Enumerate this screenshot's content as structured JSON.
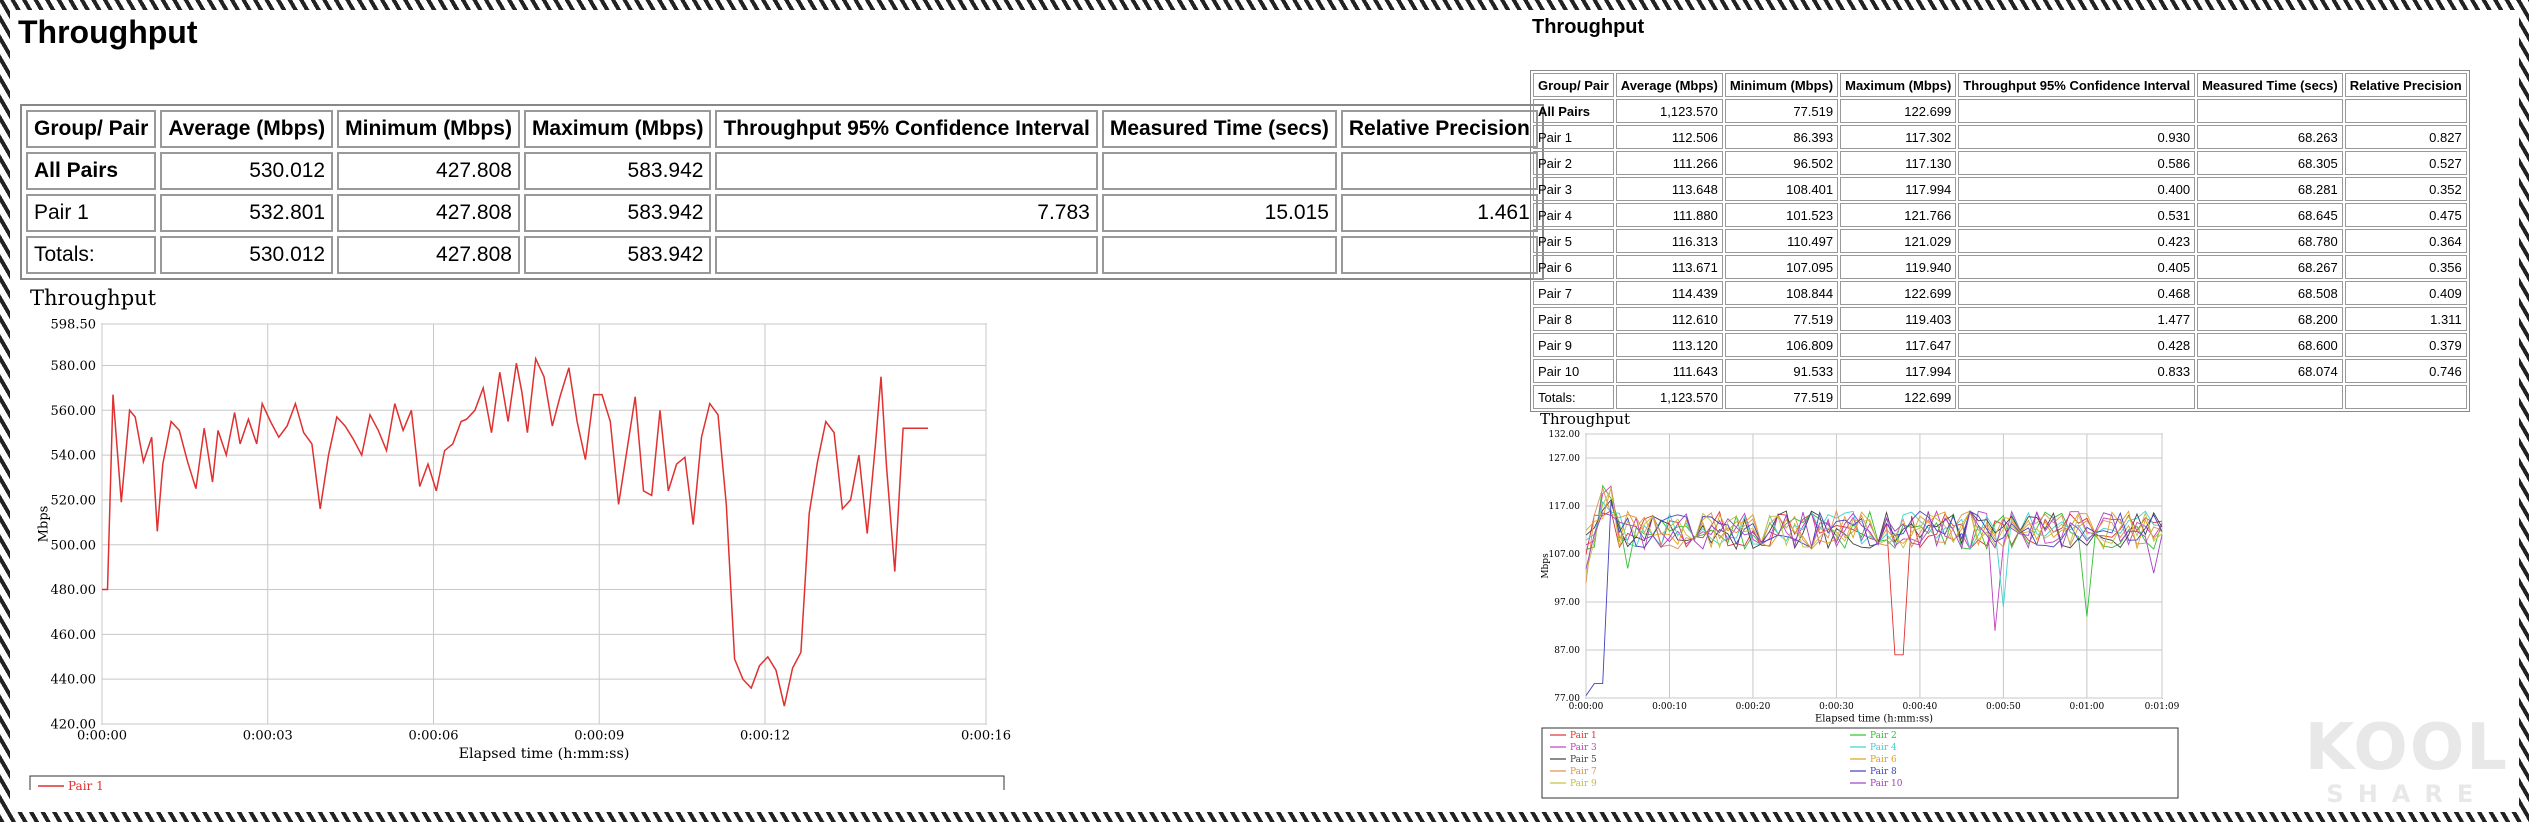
{
  "left": {
    "title": "Throughput",
    "table": {
      "headers": [
        "Group/ Pair",
        "Average (Mbps)",
        "Minimum (Mbps)",
        "Maximum (Mbps)",
        "Throughput 95% Confidence Interval",
        "Measured Time (secs)",
        "Relative Precision"
      ],
      "rows": [
        [
          "All Pairs",
          "530.012",
          "427.808",
          "583.942",
          "",
          "",
          ""
        ],
        [
          "Pair 1",
          "532.801",
          "427.808",
          "583.942",
          "7.783",
          "15.015",
          "1.461"
        ],
        [
          "Totals:",
          "530.012",
          "427.808",
          "583.942",
          "",
          "",
          ""
        ]
      ]
    }
  },
  "right": {
    "title": "Throughput",
    "table": {
      "headers": [
        "Group/ Pair",
        "Average (Mbps)",
        "Minimum (Mbps)",
        "Maximum (Mbps)",
        "Throughput 95% Confidence Interval",
        "Measured Time (secs)",
        "Relative Precision"
      ],
      "rows": [
        [
          "All Pairs",
          "1,123.570",
          "77.519",
          "122.699",
          "",
          "",
          ""
        ],
        [
          "Pair 1",
          "112.506",
          "86.393",
          "117.302",
          "0.930",
          "68.263",
          "0.827"
        ],
        [
          "Pair 2",
          "111.266",
          "96.502",
          "117.130",
          "0.586",
          "68.305",
          "0.527"
        ],
        [
          "Pair 3",
          "113.648",
          "108.401",
          "117.994",
          "0.400",
          "68.281",
          "0.352"
        ],
        [
          "Pair 4",
          "111.880",
          "101.523",
          "121.766",
          "0.531",
          "68.645",
          "0.475"
        ],
        [
          "Pair 5",
          "116.313",
          "110.497",
          "121.029",
          "0.423",
          "68.780",
          "0.364"
        ],
        [
          "Pair 6",
          "113.671",
          "107.095",
          "119.940",
          "0.405",
          "68.267",
          "0.356"
        ],
        [
          "Pair 7",
          "114.439",
          "108.844",
          "122.699",
          "0.468",
          "68.508",
          "0.409"
        ],
        [
          "Pair 8",
          "112.610",
          "77.519",
          "119.403",
          "1.477",
          "68.200",
          "1.311"
        ],
        [
          "Pair 9",
          "113.120",
          "106.809",
          "117.647",
          "0.428",
          "68.600",
          "0.379"
        ],
        [
          "Pair 10",
          "111.643",
          "91.533",
          "117.994",
          "0.833",
          "68.074",
          "0.746"
        ],
        [
          "Totals:",
          "1,123.570",
          "77.519",
          "122.699",
          "",
          "",
          ""
        ]
      ]
    }
  },
  "chart_data": [
    {
      "type": "line",
      "title": "Throughput",
      "xlabel": "Elapsed time (h:mm:ss)",
      "ylabel": "Mbps",
      "xlim": [
        0,
        16
      ],
      "ylim": [
        420.0,
        598.5
      ],
      "yticks": [
        "598.50",
        "580.00",
        "560.00",
        "540.00",
        "520.00",
        "500.00",
        "480.00",
        "460.00",
        "440.00",
        "420.00"
      ],
      "ytick_values": [
        598.5,
        580,
        560,
        540,
        520,
        500,
        480,
        460,
        440,
        420
      ],
      "xticks": [
        "0:00:00",
        "0:00:03",
        "0:00:06",
        "0:00:09",
        "0:00:12",
        "0:00:16"
      ],
      "xtick_values": [
        0,
        3,
        6,
        9,
        12,
        16
      ],
      "grid": true,
      "legend": "bottom",
      "series": [
        {
          "name": "Pair 1",
          "color": "#e03030",
          "x": [
            0,
            0.1,
            0.2,
            0.35,
            0.5,
            0.6,
            0.75,
            0.9,
            1.0,
            1.1,
            1.25,
            1.4,
            1.55,
            1.7,
            1.85,
            2.0,
            2.1,
            2.25,
            2.4,
            2.5,
            2.65,
            2.8,
            2.9,
            3.05,
            3.2,
            3.35,
            3.5,
            3.65,
            3.8,
            3.95,
            4.1,
            4.25,
            4.4,
            4.55,
            4.7,
            4.85,
            5.0,
            5.15,
            5.3,
            5.45,
            5.6,
            5.75,
            5.9,
            6.05,
            6.2,
            6.35,
            6.5,
            6.6,
            6.75,
            6.9,
            7.05,
            7.2,
            7.35,
            7.5,
            7.6,
            7.7,
            7.85,
            8.0,
            8.15,
            8.3,
            8.45,
            8.6,
            8.75,
            8.9,
            9.05,
            9.2,
            9.35,
            9.5,
            9.65,
            9.8,
            9.95,
            10.1,
            10.25,
            10.4,
            10.55,
            10.7,
            10.85,
            11.0,
            11.15,
            11.3,
            11.45,
            11.6,
            11.75,
            11.9,
            12.05,
            12.2,
            12.35,
            12.5,
            12.65,
            12.8,
            12.95,
            13.1,
            13.25,
            13.4,
            13.55,
            13.7,
            13.85,
            14.0,
            14.1,
            14.2,
            14.35,
            14.5,
            14.65,
            14.8,
            14.95
          ],
          "y": [
            480,
            480,
            567,
            519,
            560,
            557,
            537,
            548,
            506,
            536,
            555,
            551,
            537,
            525,
            552,
            528,
            551,
            540,
            559,
            545,
            556,
            545,
            563,
            555,
            548,
            553,
            563,
            550,
            545,
            516,
            540,
            557,
            553,
            547,
            540,
            558,
            551,
            542,
            563,
            551,
            560,
            526,
            536,
            524,
            542,
            545,
            555,
            556,
            560,
            570,
            550,
            577,
            555,
            581,
            568,
            550,
            583,
            575,
            553,
            567,
            579,
            555,
            538,
            567,
            567,
            555,
            518,
            542,
            566,
            524,
            522,
            560,
            524,
            536,
            539,
            509,
            548,
            563,
            558,
            518,
            449,
            440,
            436,
            446,
            450,
            444,
            428,
            445,
            452,
            514,
            537,
            555,
            550,
            516,
            520,
            540,
            505,
            545,
            575,
            535,
            488,
            552,
            552,
            552,
            552
          ]
        }
      ]
    },
    {
      "type": "line",
      "title": "Throughput",
      "xlabel": "Elapsed time (h:mm:ss)",
      "ylabel": "Mbps",
      "xlim": [
        0,
        69
      ],
      "ylim": [
        77.0,
        132.0
      ],
      "yticks": [
        "132.00",
        "127.00",
        "117.00",
        "107.00",
        "97.00",
        "87.00",
        "77.00"
      ],
      "ytick_values": [
        132,
        127,
        117,
        107,
        97,
        87,
        77
      ],
      "xticks": [
        "0:00:00",
        "0:00:10",
        "0:00:20",
        "0:00:30",
        "0:00:40",
        "0:00:50",
        "0:01:00",
        "0:01:09"
      ],
      "xtick_values": [
        0,
        10,
        20,
        30,
        40,
        50,
        60,
        69
      ],
      "grid": true,
      "legend": "bottom",
      "series": [
        {
          "name": "Pair 1",
          "color": "#e03030"
        },
        {
          "name": "Pair 2",
          "color": "#30c030"
        },
        {
          "name": "Pair 3",
          "color": "#c040c0"
        },
        {
          "name": "Pair 4",
          "color": "#40d0d0"
        },
        {
          "name": "Pair 5",
          "color": "#404040"
        },
        {
          "name": "Pair 6",
          "color": "#e0a020"
        },
        {
          "name": "Pair 7",
          "color": "#e09050"
        },
        {
          "name": "Pair 8",
          "color": "#4040c0"
        },
        {
          "name": "Pair 9",
          "color": "#c0c040"
        },
        {
          "name": "Pair 10",
          "color": "#a040c0"
        }
      ]
    }
  ],
  "watermark": {
    "main": "KOOL",
    "sub": "SHARE"
  }
}
